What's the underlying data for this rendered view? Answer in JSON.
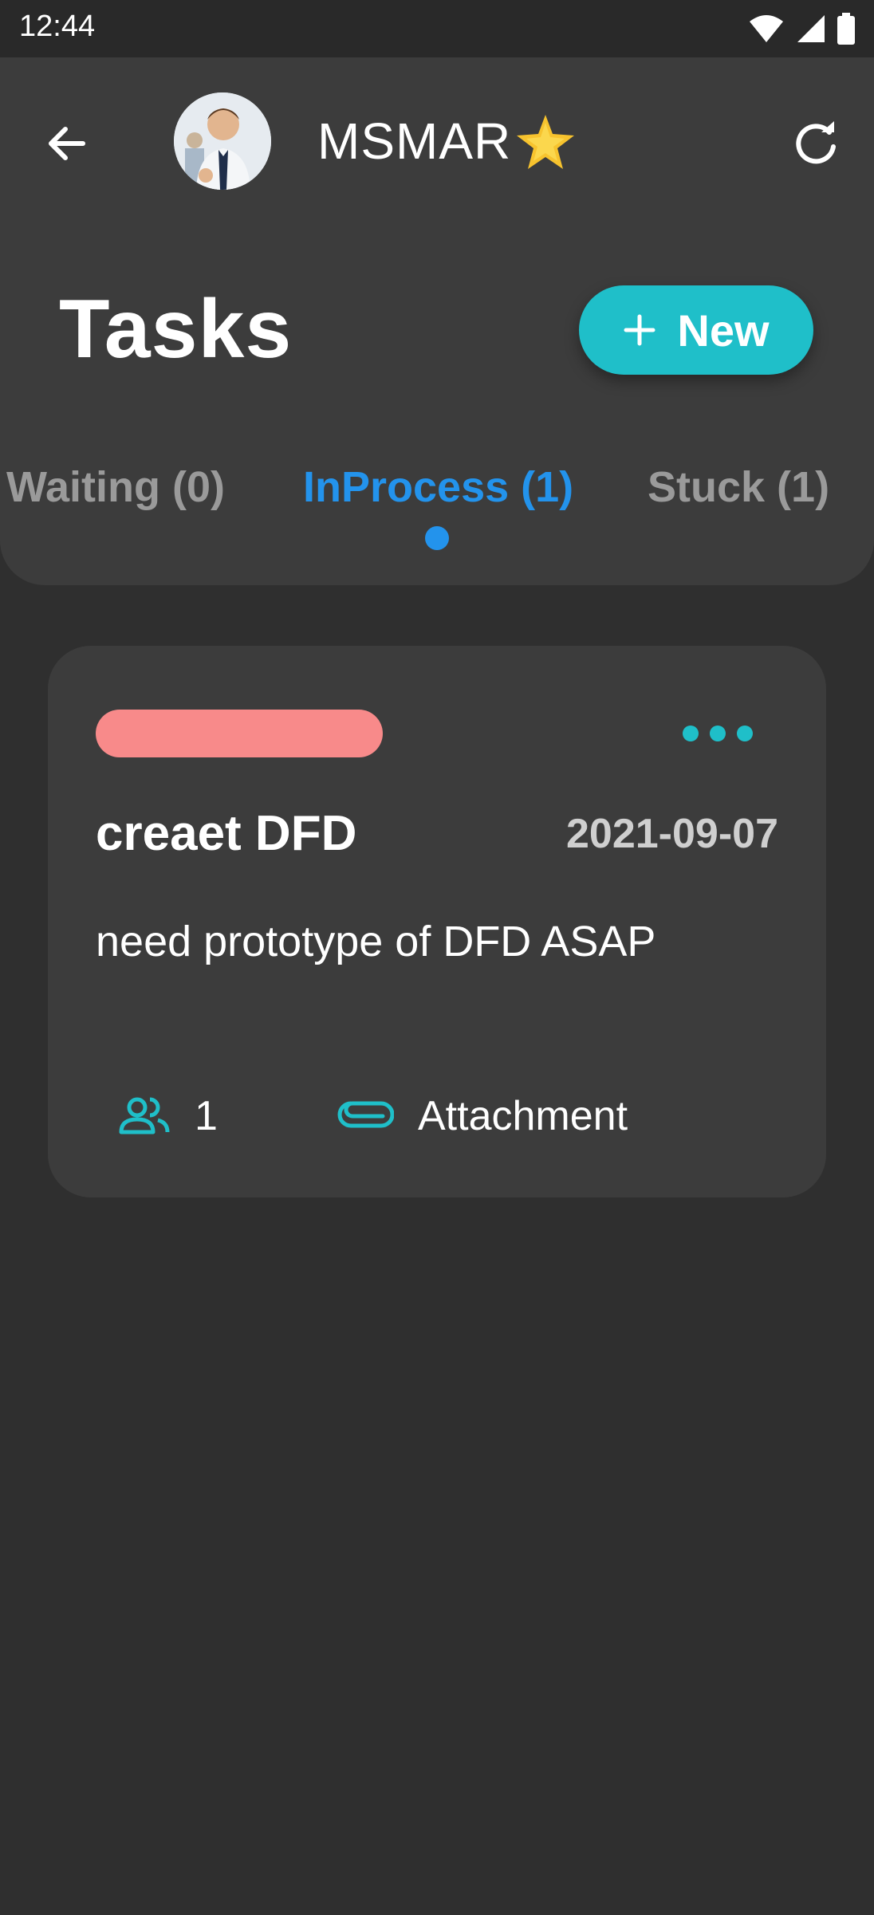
{
  "status_bar": {
    "time": "12:44"
  },
  "header": {
    "user_name": "MSMAR",
    "title": "Tasks",
    "new_button_label": "New"
  },
  "tabs": [
    {
      "label": "Waiting (0)",
      "active": false
    },
    {
      "label": "InProcess (1)",
      "active": true
    },
    {
      "label": "Stuck (1)",
      "active": false
    }
  ],
  "task": {
    "title": "creaet DFD",
    "date": "2021-09-07",
    "description": "need prototype of DFD ASAP",
    "members_count": "1",
    "attachment_label": "Attachment",
    "priority_color": "#f88a8a"
  },
  "colors": {
    "accent": "#1fbfc9",
    "active_tab": "#2393ec",
    "background": "#2f2f2f",
    "panel": "#3c3c3c"
  },
  "icons": [
    "back-arrow-icon",
    "star-icon",
    "refresh-icon",
    "plus-icon",
    "more-dots-icon",
    "people-icon",
    "paperclip-icon",
    "wifi-icon",
    "signal-icon",
    "battery-icon"
  ]
}
